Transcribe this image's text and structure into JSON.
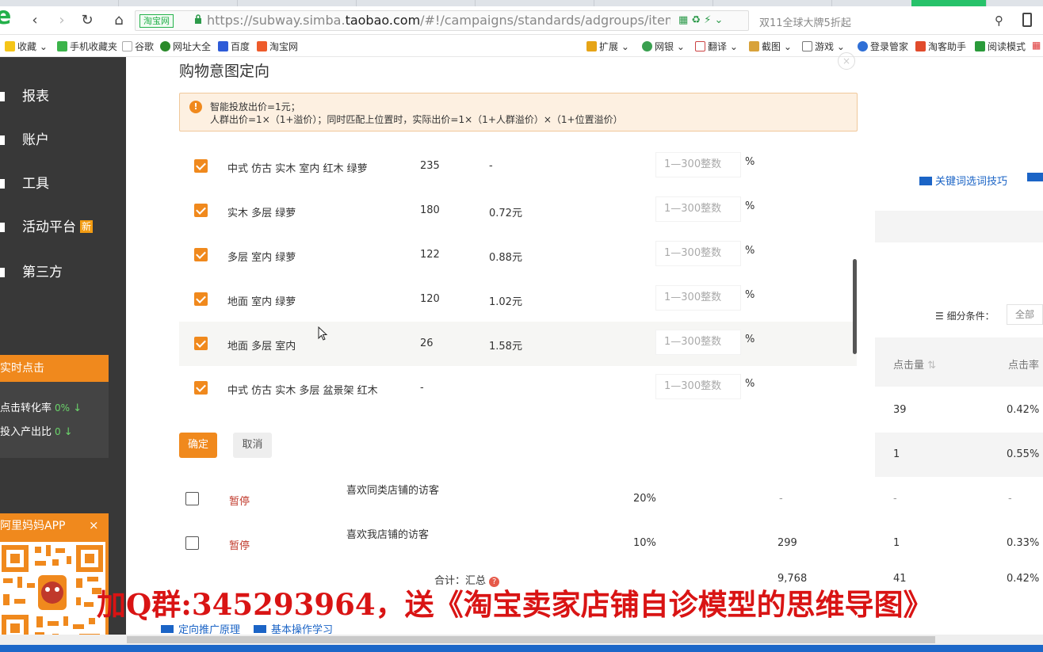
{
  "browser": {
    "site_badge": "淘宝网",
    "url_domain": "https://subway.simba.",
    "url_host": "taobao.com",
    "url_path": "/#!/campaigns/standards/adgroups/items/deta",
    "promo": "双11全球大牌5折起"
  },
  "bookmarks": [
    {
      "label": "收藏"
    },
    {
      "label": "手机收藏夹"
    },
    {
      "label": "谷歌"
    },
    {
      "label": "网址大全"
    },
    {
      "label": "百度"
    },
    {
      "label": "淘宝网"
    },
    {
      "label": "扩展"
    },
    {
      "label": "网银"
    },
    {
      "label": "翻译"
    },
    {
      "label": "截图"
    },
    {
      "label": "游戏"
    },
    {
      "label": "登录管家"
    },
    {
      "label": "淘客助手"
    },
    {
      "label": "阅读模式"
    }
  ],
  "sidebar": {
    "items": [
      {
        "label": "报表"
      },
      {
        "label": "账户"
      },
      {
        "label": "工具"
      },
      {
        "label": "活动平台",
        "badge": "新"
      },
      {
        "label": "第三方"
      }
    ],
    "realtime": {
      "title": "实时点击",
      "rows": [
        {
          "label": "点击转化率",
          "value": "0%"
        },
        {
          "label": "投入产出比",
          "value": "0"
        }
      ]
    },
    "app": {
      "title": "阿里妈妈APP",
      "close": "×"
    }
  },
  "modal": {
    "title": "购物意图定向",
    "close": "×",
    "notice_line1": "智能投放出价=1元；",
    "notice_line2": "人群出价=1×（1+溢价）；同时匹配上位置时，实际出价=1×（1+人群溢价）×（1+位置溢价）",
    "rows": [
      {
        "keyword": "中式 仿古 实木 室内 红木 绿萝",
        "count": "235",
        "price": "-",
        "placeholder": "1—300整数",
        "unit": "%"
      },
      {
        "keyword": "实木 多层 绿萝",
        "count": "180",
        "price": "0.72元",
        "placeholder": "1—300整数",
        "unit": "%"
      },
      {
        "keyword": "多层 室内 绿萝",
        "count": "122",
        "price": "0.88元",
        "placeholder": "1—300整数",
        "unit": "%"
      },
      {
        "keyword": "地面 室内 绿萝",
        "count": "120",
        "price": "1.02元",
        "placeholder": "1—300整数",
        "unit": "%"
      },
      {
        "keyword": "地面 多层 室内",
        "count": "26",
        "price": "1.58元",
        "placeholder": "1—300整数",
        "unit": "%"
      },
      {
        "keyword": "中式 仿古 实木 多层 盆景架 红木",
        "count": "-",
        "price": "",
        "placeholder": "1—300整数",
        "unit": "%"
      }
    ],
    "ok": "确定",
    "cancel": "取消"
  },
  "background": {
    "tip_link": "关键词选词技巧",
    "filter_label": "细分条件：",
    "filter_value": "全部",
    "col_clicks": "点击量",
    "col_ctr": "点击率",
    "right_rows": [
      {
        "clicks": "39",
        "ctr": "0.42%"
      },
      {
        "clicks": "1",
        "ctr": "0.55%"
      }
    ],
    "table_rows": [
      {
        "status": "暂停",
        "name": "喜欢同类店铺的访客",
        "premium": "20%",
        "impr": "-",
        "clicks": "-",
        "ctr": "-"
      },
      {
        "status": "暂停",
        "name": "喜欢我店铺的访客",
        "premium": "10%",
        "impr": "299",
        "clicks": "1",
        "ctr": "0.33%"
      }
    ],
    "total_label": "合计：汇总",
    "total_impr": "9,768",
    "total_clicks": "41",
    "total_ctr": "0.42%",
    "footer_link1": "定向推广原理",
    "footer_link2": "基本操作学习"
  },
  "caption": "加Q群:345293964，送《淘宝卖家店铺自诊模型的思维导图》"
}
